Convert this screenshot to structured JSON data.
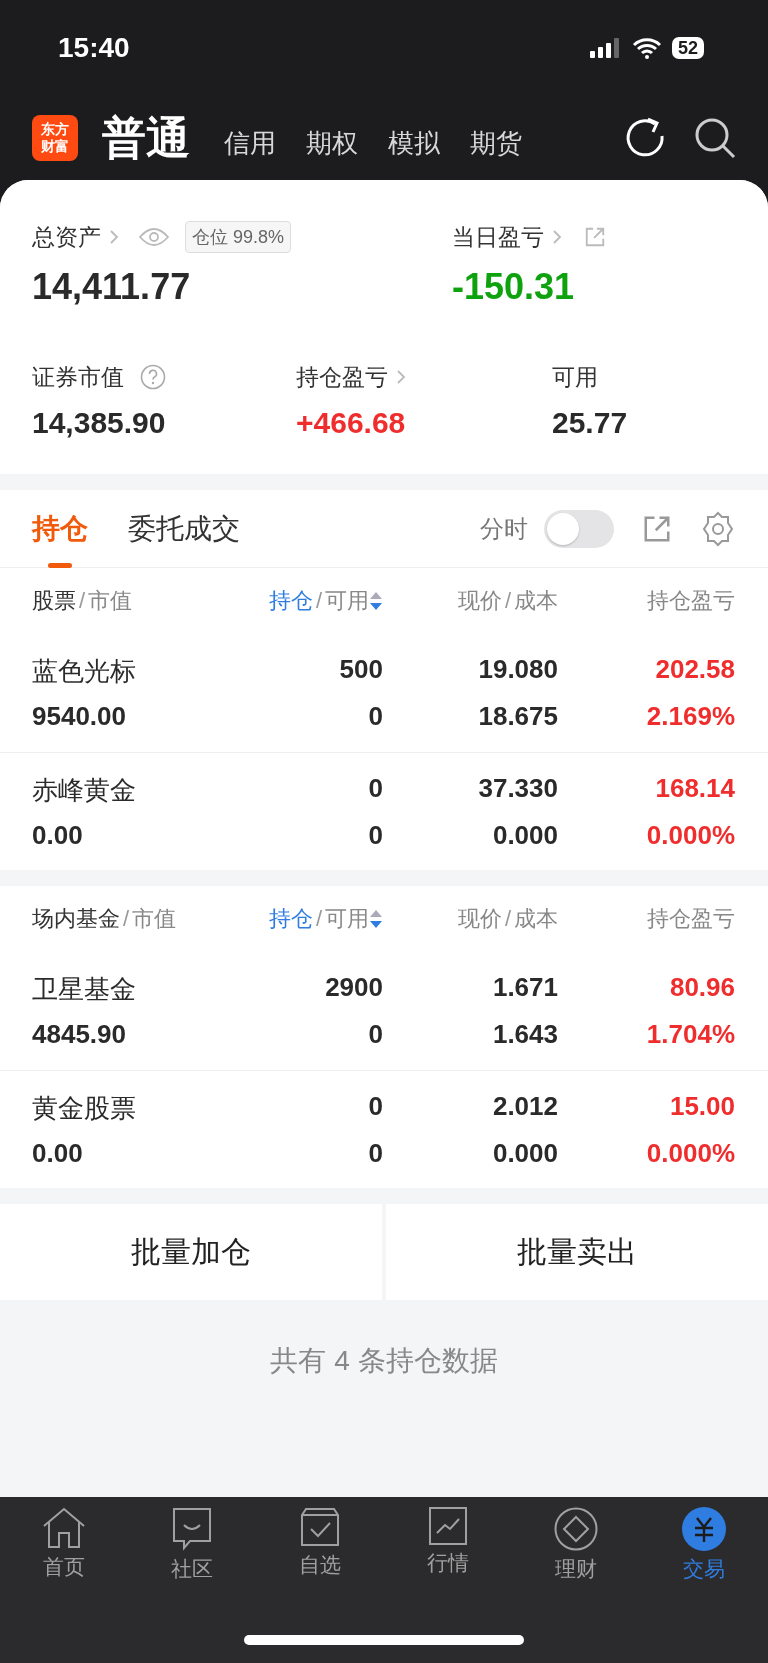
{
  "status_bar": {
    "time": "15:40",
    "battery": "52"
  },
  "header": {
    "logo_lines": [
      "东方",
      "财富"
    ],
    "account_tabs": [
      {
        "label": "普通",
        "selected": true
      },
      {
        "label": "信用",
        "selected": false
      },
      {
        "label": "期权",
        "selected": false
      },
      {
        "label": "模拟",
        "selected": false
      },
      {
        "label": "期货",
        "selected": false
      }
    ]
  },
  "summary": {
    "total_assets": {
      "label": "总资产",
      "value": "14,411.77",
      "position_badge": "仓位 99.8%"
    },
    "daily_pl": {
      "label": "当日盈亏",
      "value": "-150.31",
      "color": "#0fa20f"
    },
    "stats": [
      {
        "label": "证券市值",
        "value": "14,385.90",
        "color": "#2a2a2a"
      },
      {
        "label": "持仓盈亏",
        "value": "+466.68",
        "color": "#f02d2d"
      },
      {
        "label": "可用",
        "value": "25.77",
        "color": "#2a2a2a"
      }
    ]
  },
  "holdings_tabs": [
    {
      "label": "持仓",
      "selected": true
    },
    {
      "label": "委托成交",
      "selected": false
    }
  ],
  "timeshare_toggle": {
    "label": "分时",
    "on": false
  },
  "sections": [
    {
      "header": [
        [
          "股票",
          "/",
          "市值"
        ],
        [
          "持仓",
          "/",
          "可用"
        ],
        [
          "现价",
          "/",
          "成本"
        ],
        [
          "持仓盈亏"
        ]
      ],
      "rows": [
        {
          "name": "蓝色光标",
          "market_value": "9540.00",
          "holding": "500",
          "available": "0",
          "price": "19.080",
          "cost": "18.675",
          "pl": "202.58",
          "pl_pct": "2.169%",
          "color": "#f02d2d"
        },
        {
          "name": "赤峰黄金",
          "market_value": "0.00",
          "holding": "0",
          "available": "0",
          "price": "37.330",
          "cost": "0.000",
          "pl": "168.14",
          "pl_pct": "0.000%",
          "color": "#f02d2d"
        }
      ]
    },
    {
      "header": [
        [
          "场内基金",
          "/",
          "市值"
        ],
        [
          "持仓",
          "/",
          "可用"
        ],
        [
          "现价",
          "/",
          "成本"
        ],
        [
          "持仓盈亏"
        ]
      ],
      "rows": [
        {
          "name": "卫星基金",
          "market_value": "4845.90",
          "holding": "2900",
          "available": "0",
          "price": "1.671",
          "cost": "1.643",
          "pl": "80.96",
          "pl_pct": "1.704%",
          "color": "#f02d2d"
        },
        {
          "name": "黄金股票",
          "market_value": "0.00",
          "holding": "0",
          "available": "0",
          "price": "2.012",
          "cost": "0.000",
          "pl": "15.00",
          "pl_pct": "0.000%",
          "color": "#f02d2d"
        }
      ]
    }
  ],
  "batch_buttons": [
    "批量加仓",
    "批量卖出"
  ],
  "footer_note": "共有 4 条持仓数据",
  "bottom_nav": [
    {
      "kind": "home",
      "label": "首页",
      "selected": false
    },
    {
      "kind": "community",
      "label": "社区",
      "selected": false
    },
    {
      "kind": "watchlist",
      "label": "自选",
      "selected": false
    },
    {
      "kind": "market",
      "label": "行情",
      "selected": false
    },
    {
      "kind": "wealth",
      "label": "理财",
      "selected": false
    },
    {
      "kind": "trade",
      "label": "交易",
      "selected": true
    }
  ]
}
